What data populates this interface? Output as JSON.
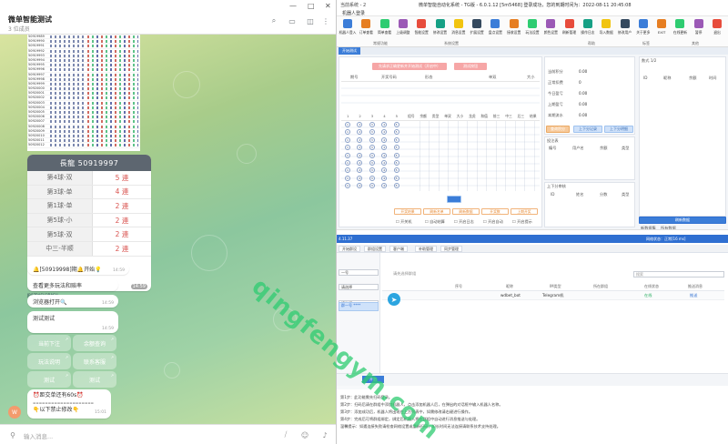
{
  "telegram": {
    "title": "微单智能测试",
    "subtitle": "3 位成员",
    "window_controls": [
      "—",
      "□",
      "✕"
    ],
    "header_icons": [
      "search-icon",
      "chat-icon",
      "sidebar-icon",
      "more-icon"
    ],
    "table_ids": [
      "50919989",
      "50919990",
      "50919991",
      "50919992",
      "50919993",
      "50919994",
      "50919995",
      "50919996",
      "50919997",
      "50919998",
      "50919999",
      "50920000",
      "50920001",
      "50920002",
      "50920003",
      "50920004",
      "50920005",
      "50920006",
      "50920007",
      "50920008",
      "50920009",
      "50920010",
      "50920011",
      "50920012"
    ],
    "long_dragon": {
      "title": "長龍 50919997",
      "rows": [
        {
          "label": "第4球-双",
          "value": "5 連"
        },
        {
          "label": "第3球-单",
          "value": "4 連"
        },
        {
          "label": "第1球-单",
          "value": "2 連"
        },
        {
          "label": "第5球-小",
          "value": "2 連"
        },
        {
          "label": "第5球-双",
          "value": "2 連"
        },
        {
          "label": "中三-半顺",
          "value": "2 連"
        }
      ],
      "time": "14:59"
    },
    "jr_text": "JR87BASH3BASH",
    "messages": [
      {
        "text": "🔔[50919998]期🔔开始💡",
        "time": "14:59"
      },
      {
        "text": "查看更多玩法和赔率",
        "time": ""
      },
      {
        "text": "浏览器打开🔍",
        "time": "14:59"
      },
      {
        "text": "测试测试",
        "time": "14:59"
      }
    ],
    "keyboard": [
      [
        "当前下注",
        "余额查询"
      ],
      [
        "玩法说明",
        "联系客服"
      ],
      [
        "测试",
        "测试"
      ]
    ],
    "closing_msg": {
      "line1": "⏰距交单还有60s⏰",
      "line2": "====================",
      "line3": "👇以下禁止修改👇",
      "time": "15:01"
    },
    "avatar_letter": "W",
    "input_placeholder": "输入消息..."
  },
  "watermark": "qingfengym.com",
  "app_top": {
    "title_left": "当前系统 - 2",
    "title_sub": "机器人登录",
    "title_main": "微单智能自动化系统 - TG版 - 6.0.1.12   [5m5468] 登录成功，您的到期时间为：2022-08-11 20:45:08",
    "toolbar": [
      "机器人登入",
      "订单查看",
      "简单查看",
      "上级调整",
      "智能设置",
      "修改设置",
      "消息设置",
      "扩展设置",
      "盘点设置",
      "接收设置",
      "玩法设置",
      "颜色设置",
      "刷新管理",
      "操作日志",
      "导入数据",
      "修改用户",
      "关于更多",
      "EXIT",
      "在线更新",
      "暂停",
      "退出"
    ],
    "toolbar_groups": [
      "常规功能",
      "系统设置",
      "帮助",
      "标签",
      "其他"
    ],
    "tab": "开始测试",
    "red_button": "先请求正确更新并开始测试（开启中）",
    "red_button2": "测试按钮",
    "grid_headers": [
      "期号",
      "开奖号码",
      "形态",
      "单双",
      "大小"
    ],
    "stats": [
      {
        "label": "当前积分",
        "value": "0.00"
      },
      {
        "label": "正常扣费",
        "value": "0"
      },
      {
        "label": "今日盈亏",
        "value": "0.00"
      },
      {
        "label": "上期盈亏",
        "value": "0.00"
      },
      {
        "label": "本期流水",
        "value": "0.00"
      }
    ],
    "stat_buttons": [
      "查询积分",
      "上下分记录",
      "上下分明细"
    ],
    "right_panel_title": "数式 1/2",
    "right_cols": [
      "ID",
      "昵称",
      "余额",
      "时间"
    ],
    "bet_panel_title": "投注表",
    "bet_cols": [
      "编号",
      "用户名",
      "余额",
      "类型"
    ],
    "bottom_panel_title": "上下分审核",
    "bottom_cols": [
      "ID",
      "姓名",
      "分数",
      "类型"
    ],
    "bottom_blue_btn": "刷新数据",
    "bottom_tabs": [
      "新数据集",
      "所有数据"
    ],
    "filter_buttons": [
      "开奖结果",
      "刷新名单",
      "刷新数据",
      "开奖数",
      "上期开奖"
    ],
    "check_labels": [
      "开关机",
      "自动结算",
      "开启日志",
      "开启自动",
      "开启提示"
    ],
    "numbers_row": [
      "1",
      "2",
      "3",
      "4",
      "5",
      "组号",
      "余额",
      "类型",
      "单双",
      "大小",
      "龙虎",
      "和值",
      "前三",
      "中三",
      "后三",
      "结果"
    ]
  },
  "app_bottom": {
    "title_left": "4.11.37",
    "title_right": "网络状态：正常[16 ms]",
    "tabs": [
      "开始群设",
      "群组设置",
      "客户端",
      "补助管理",
      "同步管理"
    ],
    "selects": [
      "一号",
      "请选择",
      "请选择"
    ],
    "selected_item": "群一号 ****",
    "search_placeholder": "搜索",
    "table_headers": [
      "序号",
      "昵称",
      "IM类型",
      "所在群组",
      "在线状态",
      "推送消息"
    ],
    "row": {
      "name": "wdbet_bot",
      "type": "Telegram机",
      "status": "在线",
      "push": "推送"
    },
    "tip": "请先选择群组",
    "go_button": "开启",
    "help_lines": [
      "第1步：此功能需先扫码登录。",
      "第2步：扫码后请在群组中添加机器人，点击添加机器人后，在弹出的对话框中输入机器人名称。",
      "第3步：添加成功后，机器人将出现在上方列表中，如需修改请右键进行操作。",
      "第4步：完成后可将群组绑定，绑定后机器人将在群组中自动进行消息推送与处理。",
      "温馨提示：如遇连接失败请检查网络设置或重新扫码，如长时间无法连接请联系技术支持处理。"
    ]
  },
  "colors": {
    "accent": "#2f6fd1",
    "tg_green": "#8cc79e",
    "dragon_red": "#d9534f",
    "watermark": "#2ecc71"
  }
}
